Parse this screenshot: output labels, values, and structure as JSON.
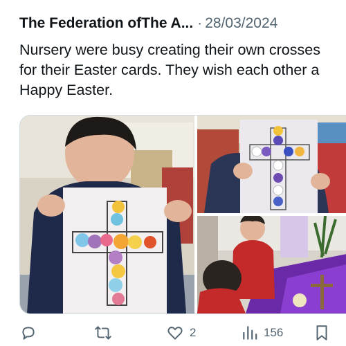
{
  "tweet": {
    "author": "The Federation ofThe A...",
    "separator": "·",
    "date": "28/03/2024",
    "text": "Nursery were busy creating their own crosses for their Easter cards. They wish each other a Happy Easter."
  },
  "media": [
    {
      "alt": "Child holding paper cross decorated with tissue paper"
    },
    {
      "alt": "Child holding a white and purple tissue paper cross"
    },
    {
      "alt": "Children at a purple Easter display table"
    }
  ],
  "actions": {
    "reply": {
      "icon": "reply-icon",
      "count": ""
    },
    "retweet": {
      "icon": "retweet-icon",
      "count": ""
    },
    "like": {
      "icon": "heart-icon",
      "count": "2"
    },
    "views": {
      "icon": "views-icon",
      "count": "156"
    },
    "bookmark": {
      "icon": "bookmark-icon",
      "count": ""
    }
  },
  "colors": {
    "text": "#0f1419",
    "muted": "#536471",
    "border": "#cfd9de"
  }
}
